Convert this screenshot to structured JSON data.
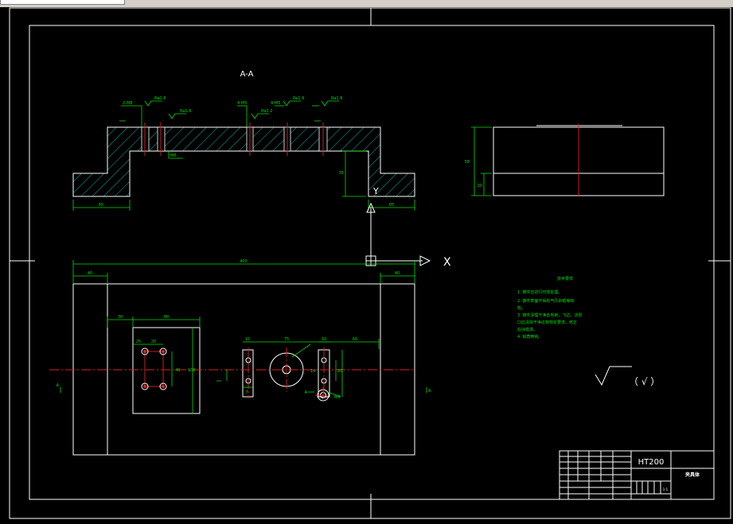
{
  "section_label": "A-A",
  "axis_x_label": "X",
  "axis_y_label": "Y",
  "section_view": {
    "dims": [
      "65",
      "65",
      "35",
      "2-M8",
      "4-M5",
      "4-M5",
      "M6",
      "Ra1.6",
      "Ra1.6",
      "Ra1.6",
      "Ra1.6",
      "Ra3.2"
    ]
  },
  "side_view": {
    "dims": [
      "58",
      "20"
    ]
  },
  "plan_view": {
    "dims": [
      "400",
      "40",
      "40",
      "30",
      "80",
      "25",
      "20",
      "40",
      "100",
      "10",
      "75",
      "10",
      "60",
      "20",
      "14",
      "7",
      "A",
      "A",
      "A",
      "M8"
    ]
  },
  "notes": {
    "title": "技术要求",
    "lines": [
      "1. 铸件应进行时效处理。",
      "2. 铸件表面不得有气孔砂眼等缺",
      "陷。",
      "3. 铸件清理干净去毛刺，飞边，浇冒",
      "口应清除干净达到规定要求，修正",
      "后涂底漆。",
      "4. 锐角倒钝。"
    ]
  },
  "roughness": {
    "left": "√",
    "right": "（ √ ）"
  },
  "title_block": {
    "material": "HT200",
    "part_name": "夹具体",
    "scale_mark": "1:1"
  },
  "colors": {
    "background": "#000000",
    "outline": "#ffffff",
    "dimension": "#00e000",
    "centerline": "#e02020"
  }
}
